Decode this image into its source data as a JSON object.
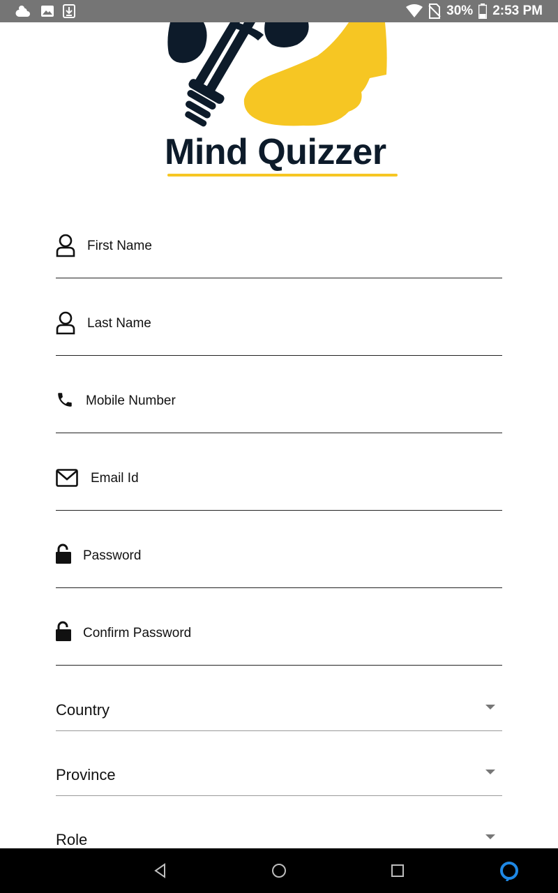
{
  "status_bar": {
    "battery_percent": "30%",
    "time": "2:53 PM",
    "icons": [
      "weather-icon",
      "image-icon",
      "download-icon",
      "wifi-icon",
      "no-sim-icon",
      "battery-icon"
    ]
  },
  "logo": {
    "text": "Mind Quizzer",
    "colors": {
      "dark": "#0d1b2a",
      "accent": "#f6c623"
    }
  },
  "form": {
    "fields": [
      {
        "icon": "user-icon",
        "placeholder": "First Name"
      },
      {
        "icon": "user-icon",
        "placeholder": "Last Name"
      },
      {
        "icon": "phone-icon",
        "placeholder": "Mobile Number"
      },
      {
        "icon": "mail-icon",
        "placeholder": "Email Id"
      },
      {
        "icon": "lock-icon",
        "placeholder": "Password"
      },
      {
        "icon": "lock-icon",
        "placeholder": "Confirm Password"
      }
    ],
    "selects": [
      {
        "label": "Country"
      },
      {
        "label": "Province"
      },
      {
        "label": "Role"
      }
    ]
  },
  "nav_bar": {
    "buttons": [
      "back-icon",
      "home-icon",
      "recents-icon",
      "assistant-icon"
    ],
    "assistant_color": "#1e88e5"
  }
}
